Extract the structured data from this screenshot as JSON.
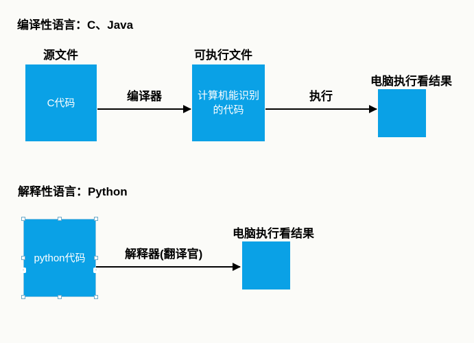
{
  "diagram": {
    "section1_title": "编译性语言：C、Java",
    "section2_title": "解释性语言：Python",
    "compiled": {
      "box1_label": "源文件",
      "box1_text": "C代码",
      "arrow1_label": "编译器",
      "box2_label": "可执行文件",
      "box2_text": "计算机能识别的代码",
      "arrow2_label": "执行",
      "box3_label": "电脑执行看结果",
      "box3_text": ""
    },
    "interpreted": {
      "box1_text": "python代码",
      "arrow1_label": "解释器(翻译官)",
      "box2_label": "电脑执行看结果",
      "box2_text": ""
    }
  }
}
